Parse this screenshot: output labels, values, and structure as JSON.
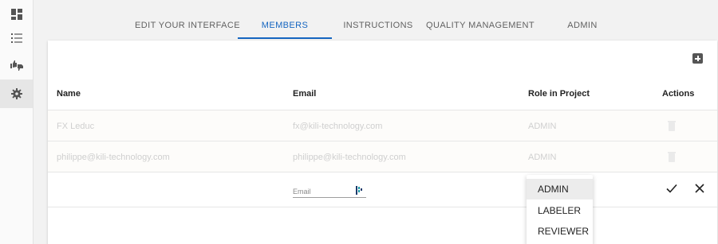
{
  "sidebar": {
    "items": [
      {
        "icon": "dashboard-icon"
      },
      {
        "icon": "list-icon"
      },
      {
        "icon": "thumbs-icon"
      },
      {
        "icon": "gear-icon",
        "active": true
      }
    ]
  },
  "tabs": [
    {
      "label": "EDIT YOUR INTERFACE"
    },
    {
      "label": "MEMBERS",
      "active": true
    },
    {
      "label": "INSTRUCTIONS"
    },
    {
      "label": "QUALITY MANAGEMENT"
    },
    {
      "label": "ADMIN"
    }
  ],
  "table": {
    "headers": {
      "name": "Name",
      "email": "Email",
      "role": "Role in Project",
      "actions": "Actions"
    },
    "rows": [
      {
        "name": "FX Leduc",
        "email": "fx@kili-technology.com",
        "role": "ADMIN"
      },
      {
        "name": "philippe@kili-technology.com",
        "email": "philippe@kili-technology.com",
        "role": "ADMIN"
      }
    ]
  },
  "new_member": {
    "email_placeholder": "Email",
    "email_value": ""
  },
  "role_menu": {
    "options": [
      "ADMIN",
      "LABELER",
      "REVIEWER"
    ],
    "selected": "ADMIN"
  },
  "colors": {
    "accent": "#1565c0",
    "muted_text": "#cfcfcf"
  }
}
